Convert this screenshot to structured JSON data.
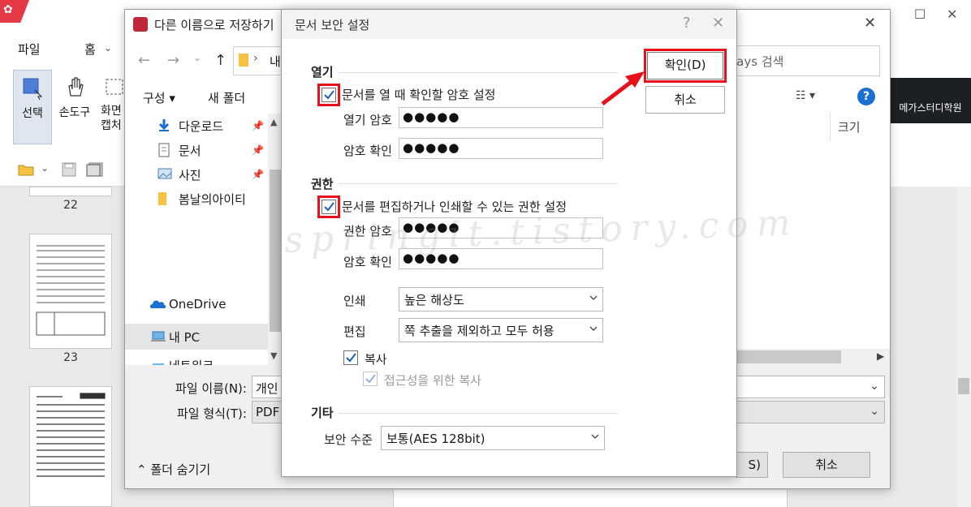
{
  "app": {
    "ribbon_tabs": [
      "파일",
      "홈"
    ],
    "ribbon_buttons": [
      "선택",
      "손도구",
      "화면 캡처"
    ],
    "thumb_labels": [
      "22",
      "23"
    ],
    "right_banner": "메가스터디학원"
  },
  "saveas": {
    "title": "다른 이름으로 저장하기",
    "address_fragment": "내",
    "search_placeholder": "lays 검색",
    "organize": "구성 ▾",
    "new_folder": "새 폴더",
    "nav_items": [
      "다운로드",
      "문서",
      "사진",
      "봄날의아이티",
      "OneDrive",
      "내 PC",
      "네트워크"
    ],
    "column_size": "크기",
    "filename_label": "파일 이름(N):",
    "filename_value": "개인",
    "filetype_label": "파일 형식(T):",
    "filetype_value": "PDF",
    "save_label_tail": "S)",
    "cancel": "취소",
    "hide_folders": "폴더 숨기기"
  },
  "security": {
    "title": "문서 보안 설정",
    "ok": "확인(D)",
    "cancel": "취소",
    "open_section": {
      "heading": "열기",
      "checkbox_label": "문서를 열 때 확인할 암호 설정",
      "checked": true,
      "open_pw_label": "열기 암호",
      "open_pw_value": "●●●●●",
      "confirm_label": "암호 확인",
      "confirm_value": "●●●●●"
    },
    "perm_section": {
      "heading": "권한",
      "checkbox_label": "문서를 편집하거나 인쇄할 수 있는 권한 설정",
      "checked": true,
      "perm_pw_label": "권한 암호",
      "perm_pw_value": "●●●●●",
      "confirm_label": "암호 확인",
      "confirm_value": "●●●●●",
      "print_label": "인쇄",
      "print_value": "높은 해상도",
      "edit_label": "편집",
      "edit_value": "쪽 추출을 제외하고 모두 허용",
      "copy_label": "복사",
      "copy_checked": true,
      "access_label": "접근성을 위한 복사",
      "access_checked": true
    },
    "other_section": {
      "heading": "기타",
      "level_label": "보안 수준",
      "level_value": "보통(AES 128bit)"
    }
  },
  "watermark": "springit.tistory.com",
  "colors": {
    "highlight_red": "#e8101a",
    "check_blue": "#1a5fb4",
    "help_blue": "#1a6fd0"
  }
}
